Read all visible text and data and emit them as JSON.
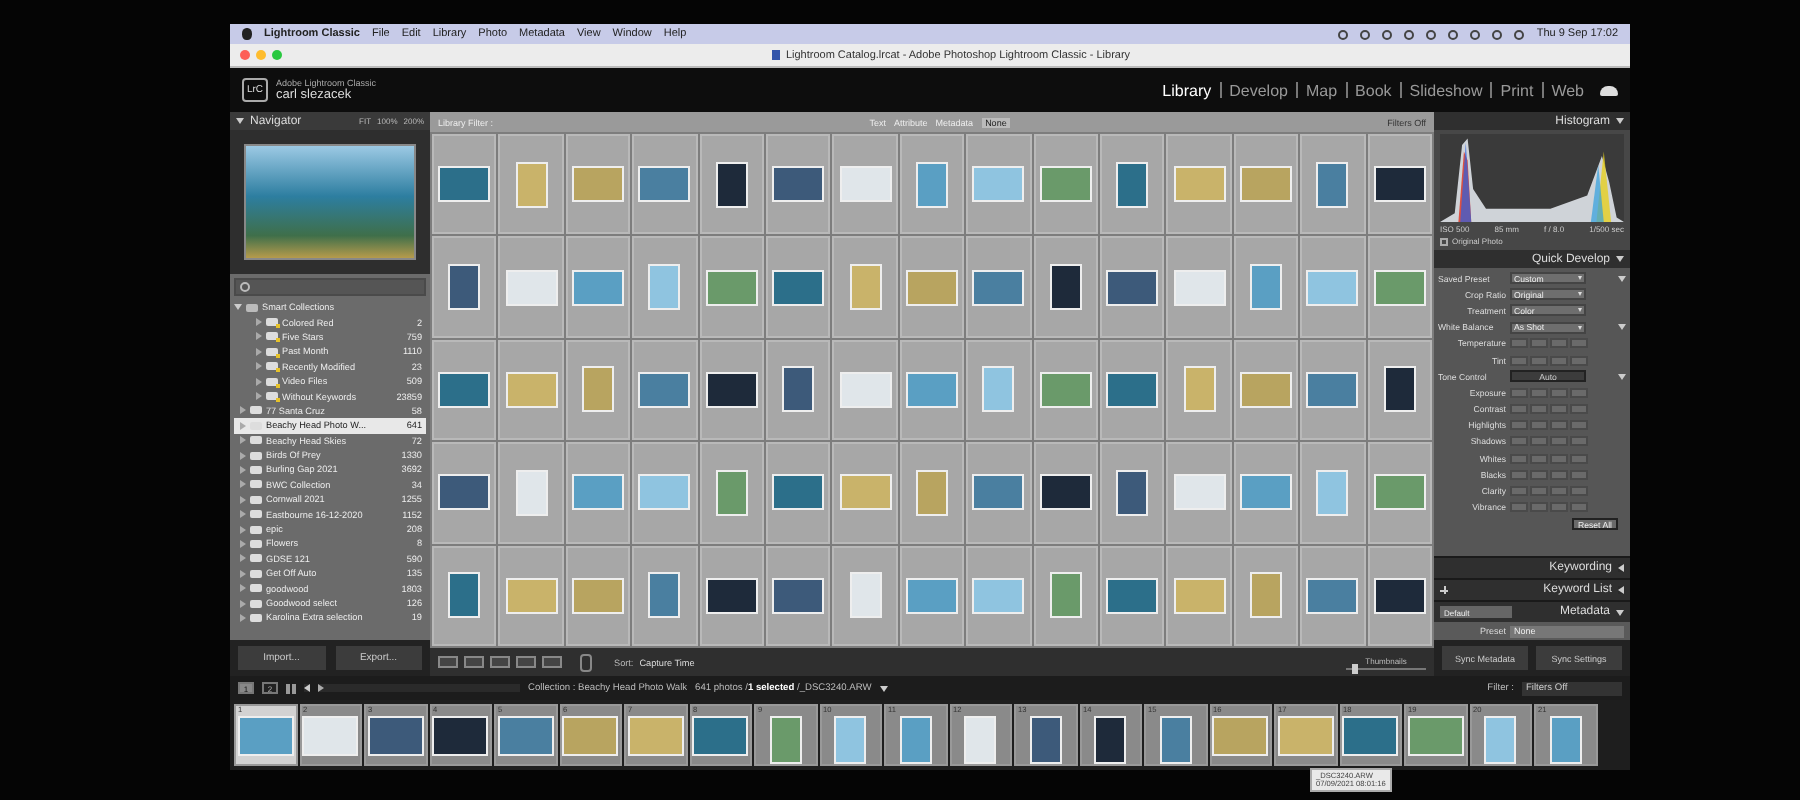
{
  "menu_bar": {
    "app": "Lightroom Classic",
    "items": [
      "File",
      "Edit",
      "Library",
      "Photo",
      "Metadata",
      "View",
      "Window",
      "Help"
    ],
    "clock": "Thu 9 Sep  17:02"
  },
  "window": {
    "title": "Lightroom Catalog.lrcat - Adobe Photoshop Lightroom Classic - Library"
  },
  "identity": {
    "logo": "LrC",
    "product": "Adobe Lightroom Classic",
    "user": "carl slezacek"
  },
  "modules": [
    {
      "label": "Library",
      "selected": true
    },
    {
      "label": "Develop",
      "selected": false
    },
    {
      "label": "Map",
      "selected": false
    },
    {
      "label": "Book",
      "selected": false
    },
    {
      "label": "Slideshow",
      "selected": false
    },
    {
      "label": "Print",
      "selected": false
    },
    {
      "label": "Web",
      "selected": false
    }
  ],
  "navigator": {
    "title": "Navigator",
    "zoom_options": [
      "FIT",
      "100%",
      "200%"
    ]
  },
  "collections": [
    {
      "label": "Smart Collections",
      "kind": "set",
      "expanded": true,
      "selected": false,
      "children": [
        {
          "label": "Colored Red",
          "count": "2",
          "kind": "smart",
          "selected": false
        },
        {
          "label": "Five Stars",
          "count": "759",
          "kind": "smart",
          "selected": false
        },
        {
          "label": "Past Month",
          "count": "1110",
          "kind": "smart",
          "selected": false
        },
        {
          "label": "Recently Modified",
          "count": "23",
          "kind": "smart",
          "selected": false
        },
        {
          "label": "Video Files",
          "count": "509",
          "kind": "smart",
          "selected": false
        },
        {
          "label": "Without Keywords",
          "count": "23859",
          "kind": "smart",
          "selected": false
        }
      ]
    },
    {
      "label": "77 Santa Cruz",
      "count": "58",
      "kind": "collection",
      "selected": false
    },
    {
      "label": "Beachy Head Photo W...",
      "count": "641",
      "kind": "collection",
      "selected": true
    },
    {
      "label": "Beachy Head Skies",
      "count": "72",
      "kind": "collection",
      "selected": false
    },
    {
      "label": "Birds Of Prey",
      "count": "1330",
      "kind": "collection",
      "selected": false
    },
    {
      "label": "Burling Gap 2021",
      "count": "3692",
      "kind": "collection",
      "selected": false
    },
    {
      "label": "BWC Collection",
      "count": "34",
      "kind": "collection",
      "selected": false
    },
    {
      "label": "Cornwall 2021",
      "count": "1255",
      "kind": "collection",
      "selected": false
    },
    {
      "label": "Eastbourne 16-12-2020",
      "count": "1152",
      "kind": "collection",
      "selected": false
    },
    {
      "label": "epic",
      "count": "208",
      "kind": "collection",
      "selected": false
    },
    {
      "label": "Flowers",
      "count": "8",
      "kind": "collection",
      "selected": false
    },
    {
      "label": "GDSE 121",
      "count": "590",
      "kind": "collection",
      "selected": false
    },
    {
      "label": "Get Off Auto",
      "count": "135",
      "kind": "collection",
      "selected": false
    },
    {
      "label": "goodwood",
      "count": "1803",
      "kind": "collection",
      "selected": false
    },
    {
      "label": "Goodwood select",
      "count": "126",
      "kind": "collection",
      "selected": false
    },
    {
      "label": "Karolina Extra selection",
      "count": "19",
      "kind": "collection",
      "selected": false
    }
  ],
  "left_buttons": [
    "Import...",
    "Export..."
  ],
  "filter_bar": {
    "title": "Library Filter :",
    "tabs": [
      {
        "label": "Text",
        "selected": false
      },
      {
        "label": "Attribute",
        "selected": false
      },
      {
        "label": "Metadata",
        "selected": false
      },
      {
        "label": "None",
        "selected": true
      }
    ],
    "preset": "Filters Off"
  },
  "toolbar": {
    "sort_label": "Sort:",
    "sort_value": "Capture Time",
    "thumbnails_label": "Thumbnails",
    "thumbnail_size": {
      "level": 0.12
    }
  },
  "histogram": {
    "title": "Histogram",
    "readouts": [
      "ISO 500",
      "85 mm",
      "f / 8.0",
      "1/500 sec"
    ],
    "original_photo": {
      "label": "Original Photo",
      "checked": false
    }
  },
  "quick_develop": {
    "title": "Quick Develop",
    "rows": [
      {
        "kind": "dropdown",
        "label": "Saved Preset",
        "value": "Custom",
        "expanded": true
      },
      {
        "kind": "dropdown",
        "label": "Crop Ratio",
        "value": "Original"
      },
      {
        "kind": "dropdown",
        "label": "Treatment",
        "value": "Color"
      },
      {
        "kind": "dropdown",
        "label": "White Balance",
        "value": "As Shot",
        "expanded": true
      },
      {
        "kind": "stepper",
        "label": "Temperature"
      },
      {
        "kind": "stepper",
        "label": "Tint"
      },
      {
        "kind": "button",
        "label": "Tone Control",
        "value": "Auto",
        "expanded": true
      },
      {
        "kind": "stepper",
        "label": "Exposure"
      },
      {
        "kind": "stepper",
        "label": "Contrast"
      },
      {
        "kind": "stepper",
        "label": "Highlights"
      },
      {
        "kind": "stepper",
        "label": "Shadows"
      },
      {
        "kind": "stepper",
        "label": "Whites"
      },
      {
        "kind": "stepper",
        "label": "Blacks"
      },
      {
        "kind": "stepper",
        "label": "Clarity"
      },
      {
        "kind": "stepper",
        "label": "Vibrance"
      },
      {
        "kind": "reset",
        "value": "Reset All"
      }
    ]
  },
  "right_sections": [
    {
      "title": "Keywording",
      "expanded": false
    },
    {
      "title": "Keyword List",
      "expanded": false
    },
    {
      "title": "Metadata",
      "expanded": true,
      "preset": "Default"
    }
  ],
  "metadata": {
    "preset_label": "Preset",
    "preset_value": "None"
  },
  "right_buttons": [
    "Sync Metadata",
    "Sync Settings"
  ],
  "filmstrip": {
    "monitors": [
      {
        "label": "1",
        "selected": true
      },
      {
        "label": "2",
        "selected": false
      }
    ],
    "source": "Collection : Beachy Head Photo Walk",
    "status": "641 photos /**1 selected** /_DSC3240.ARW",
    "filter_label": "Filter :",
    "filter_value": "Filters Off",
    "frames": [
      {
        "number": "1",
        "kind": "landscape",
        "selected": true
      },
      {
        "number": "2",
        "kind": "landscape",
        "selected": false
      },
      {
        "number": "3",
        "kind": "landscape",
        "selected": false
      },
      {
        "number": "4",
        "kind": "landscape",
        "selected": false
      },
      {
        "number": "5",
        "kind": "landscape",
        "selected": false
      },
      {
        "number": "6",
        "kind": "landscape",
        "selected": false
      },
      {
        "number": "7",
        "kind": "landscape",
        "selected": false
      },
      {
        "number": "8",
        "kind": "landscape",
        "selected": false
      },
      {
        "number": "9",
        "kind": "portrait",
        "selected": false
      },
      {
        "number": "10",
        "kind": "portrait",
        "selected": false
      },
      {
        "number": "11",
        "kind": "portrait",
        "selected": false
      },
      {
        "number": "12",
        "kind": "portrait",
        "selected": false
      },
      {
        "number": "13",
        "kind": "portrait",
        "selected": false
      },
      {
        "number": "14",
        "kind": "portrait",
        "selected": false
      },
      {
        "number": "15",
        "kind": "portrait",
        "selected": false
      },
      {
        "number": "16",
        "kind": "landscape",
        "selected": false
      },
      {
        "number": "17",
        "kind": "landscape",
        "selected": false
      },
      {
        "number": "18",
        "kind": "landscape",
        "selected": false
      },
      {
        "number": "19",
        "kind": "landscape",
        "selected": false
      },
      {
        "number": "20",
        "kind": "portrait",
        "selected": false
      },
      {
        "number": "21",
        "kind": "portrait",
        "selected": false
      }
    ],
    "tooltip": [
      "_DSC3240.ARW",
      "07/09/2021 08:01:16"
    ]
  }
}
